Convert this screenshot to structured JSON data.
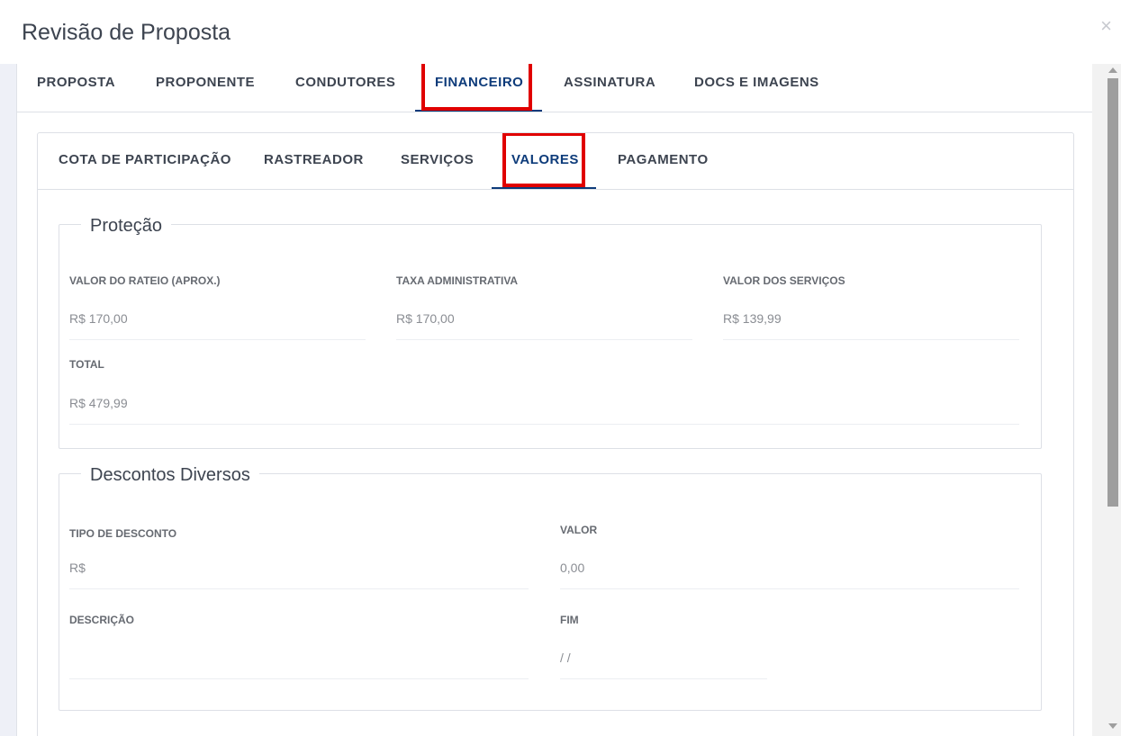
{
  "modal": {
    "title": "Revisão de Proposta",
    "close_glyph": "×"
  },
  "main_tabs": [
    {
      "label": "PROPOSTA"
    },
    {
      "label": "PROPONENTE"
    },
    {
      "label": "CONDUTORES"
    },
    {
      "label": "FINANCEIRO",
      "active": true
    },
    {
      "label": "ASSINATURA"
    },
    {
      "label": "DOCS E IMAGENS"
    }
  ],
  "sub_tabs": [
    {
      "label": "COTA DE PARTICIPAÇÃO"
    },
    {
      "label": "RASTREADOR"
    },
    {
      "label": "SERVIÇOS"
    },
    {
      "label": "VALORES",
      "active": true
    },
    {
      "label": "PAGAMENTO"
    }
  ],
  "protecao": {
    "title": "Proteção",
    "valor_rateio": {
      "label": "VALOR DO RATEIO (APROX.)",
      "value": "R$ 170,00"
    },
    "taxa_admin": {
      "label": "TAXA ADMINISTRATIVA",
      "value": "R$ 170,00"
    },
    "valor_servicos": {
      "label": "VALOR DOS SERVIÇOS",
      "value": "R$ 139,99"
    },
    "total": {
      "label": "TOTAL",
      "value": "R$ 479,99"
    }
  },
  "descontos": {
    "title": "Descontos Diversos",
    "tipo": {
      "label": "TIPO DE DESCONTO",
      "value": "R$"
    },
    "valor": {
      "label": "VALOR",
      "value": "0,00"
    },
    "descricao": {
      "label": "DESCRIÇÃO",
      "value": ""
    },
    "fim": {
      "label": "FIM",
      "value": "/ /"
    }
  },
  "colors": {
    "accent": "#0d3b7a",
    "highlight": "#e00000",
    "text": "#3d4450",
    "muted": "#8a8d93"
  }
}
